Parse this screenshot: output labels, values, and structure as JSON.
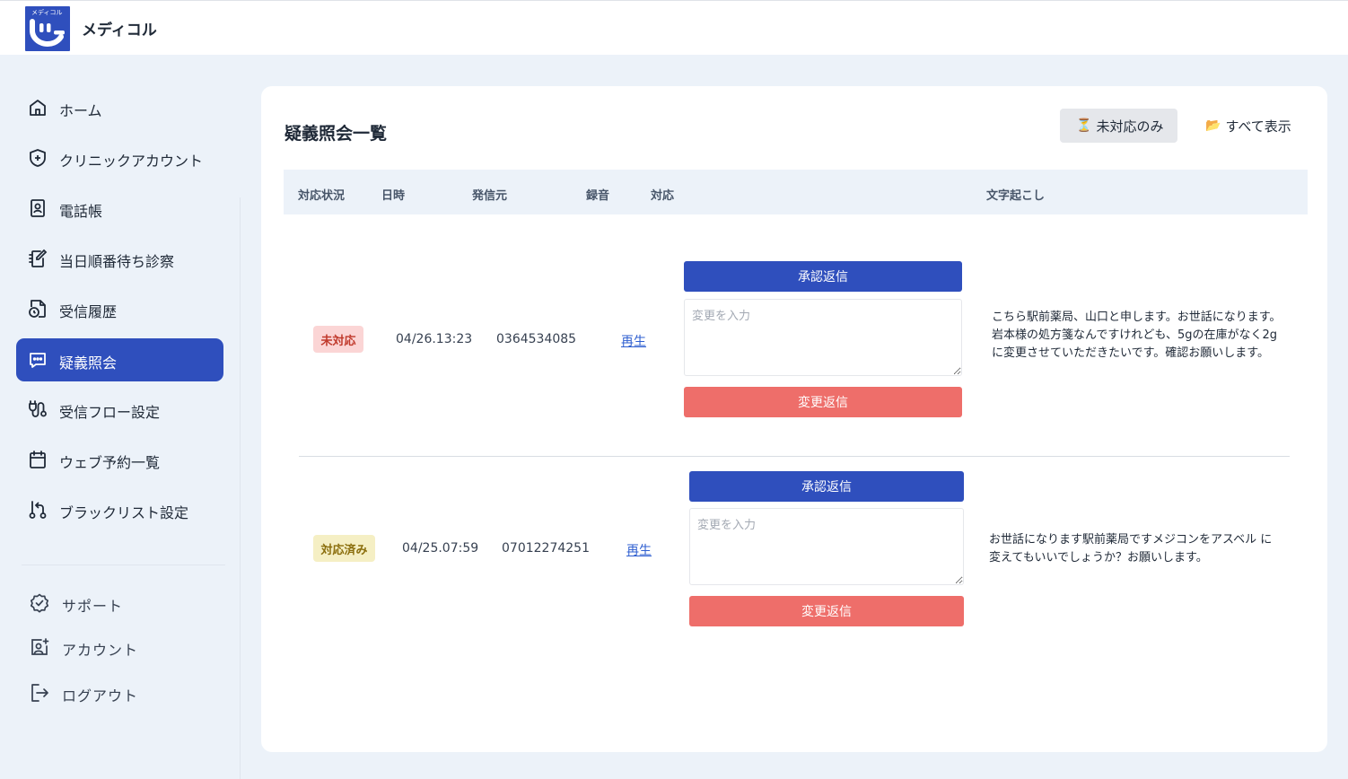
{
  "app": {
    "logo_text": "メディコル",
    "name": "メディコル"
  },
  "sidebar": {
    "items": [
      {
        "label": "ホーム",
        "icon": "home-icon"
      },
      {
        "label": "クリニックアカウント",
        "icon": "shield-plus-icon"
      },
      {
        "label": "電話帳",
        "icon": "contact-book-icon"
      },
      {
        "label": "当日順番待ち診察",
        "icon": "notebook-edit-icon"
      },
      {
        "label": "受信履歴",
        "icon": "file-clock-icon"
      },
      {
        "label": "疑義照会",
        "icon": "chat-bubble-icon",
        "active": true
      },
      {
        "label": "受信フロー設定",
        "icon": "flow-route-icon"
      },
      {
        "label": "ウェブ予約一覧",
        "icon": "calendar-icon"
      },
      {
        "label": "ブラックリスト設定",
        "icon": "git-branch-icon"
      }
    ],
    "bottom": [
      {
        "label": "サポート",
        "icon": "badge-check-icon"
      },
      {
        "label": "アカウント",
        "icon": "user-square-icon"
      },
      {
        "label": "ログアウト",
        "icon": "logout-icon"
      }
    ]
  },
  "main": {
    "title": "疑義照会一覧",
    "filters": {
      "unresolved": {
        "emoji": "⏳",
        "label": "未対応のみ"
      },
      "all": {
        "emoji": "📂",
        "label": "すべて表示"
      }
    },
    "columns": [
      "対応状況",
      "日時",
      "発信元",
      "録音",
      "対応",
      "文字起こし"
    ],
    "rows": [
      {
        "status": "未対応",
        "status_type": "pending",
        "datetime": "04/26.13:23",
        "caller": "0364534085",
        "recording": "再生",
        "approve_label": "承認返信",
        "change_placeholder": "変更を入力",
        "change_label": "変更返信",
        "transcript_lines": [
          "こちら駅前薬局、山口と申します。お世話になります。",
          "岩本様の処方箋なんですけれども、5gの在庫がなく2g",
          "に変更させていただきたいです。確認お願いします。"
        ]
      },
      {
        "status": "対応済み",
        "status_type": "done",
        "datetime": "04/25.07:59",
        "caller": "07012274251",
        "recording": "再生",
        "approve_label": "承認返信",
        "change_placeholder": "変更を入力",
        "change_label": "変更返信",
        "transcript_lines": [
          "お世話になります駅前薬局ですメジコンをアスベル に",
          "変えてもいいでしょうか？お願いします。"
        ]
      }
    ]
  },
  "colors": {
    "brand": "#2f4fbd",
    "danger": "#ee6e6a",
    "background": "#ecf2f9"
  }
}
